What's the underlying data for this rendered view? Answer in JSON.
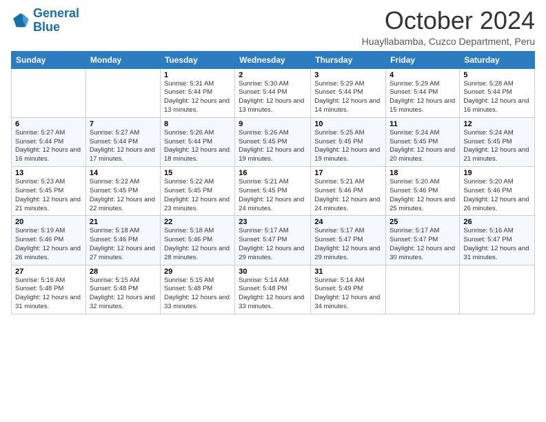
{
  "logo": {
    "line1": "General",
    "line2": "Blue"
  },
  "title": "October 2024",
  "subtitle": "Huayllabamba, Cuzco Department, Peru",
  "days_of_week": [
    "Sunday",
    "Monday",
    "Tuesday",
    "Wednesday",
    "Thursday",
    "Friday",
    "Saturday"
  ],
  "weeks": [
    [
      {
        "day": "",
        "info": ""
      },
      {
        "day": "",
        "info": ""
      },
      {
        "day": "1",
        "sunrise": "Sunrise: 5:31 AM",
        "sunset": "Sunset: 5:44 PM",
        "daylight": "Daylight: 12 hours and 13 minutes."
      },
      {
        "day": "2",
        "sunrise": "Sunrise: 5:30 AM",
        "sunset": "Sunset: 5:44 PM",
        "daylight": "Daylight: 12 hours and 13 minutes."
      },
      {
        "day": "3",
        "sunrise": "Sunrise: 5:29 AM",
        "sunset": "Sunset: 5:44 PM",
        "daylight": "Daylight: 12 hours and 14 minutes."
      },
      {
        "day": "4",
        "sunrise": "Sunrise: 5:29 AM",
        "sunset": "Sunset: 5:44 PM",
        "daylight": "Daylight: 12 hours and 15 minutes."
      },
      {
        "day": "5",
        "sunrise": "Sunrise: 5:28 AM",
        "sunset": "Sunset: 5:44 PM",
        "daylight": "Daylight: 12 hours and 16 minutes."
      }
    ],
    [
      {
        "day": "6",
        "sunrise": "Sunrise: 5:27 AM",
        "sunset": "Sunset: 5:44 PM",
        "daylight": "Daylight: 12 hours and 16 minutes."
      },
      {
        "day": "7",
        "sunrise": "Sunrise: 5:27 AM",
        "sunset": "Sunset: 5:44 PM",
        "daylight": "Daylight: 12 hours and 17 minutes."
      },
      {
        "day": "8",
        "sunrise": "Sunrise: 5:26 AM",
        "sunset": "Sunset: 5:44 PM",
        "daylight": "Daylight: 12 hours and 18 minutes."
      },
      {
        "day": "9",
        "sunrise": "Sunrise: 5:26 AM",
        "sunset": "Sunset: 5:45 PM",
        "daylight": "Daylight: 12 hours and 19 minutes."
      },
      {
        "day": "10",
        "sunrise": "Sunrise: 5:25 AM",
        "sunset": "Sunset: 5:45 PM",
        "daylight": "Daylight: 12 hours and 19 minutes."
      },
      {
        "day": "11",
        "sunrise": "Sunrise: 5:24 AM",
        "sunset": "Sunset: 5:45 PM",
        "daylight": "Daylight: 12 hours and 20 minutes."
      },
      {
        "day": "12",
        "sunrise": "Sunrise: 5:24 AM",
        "sunset": "Sunset: 5:45 PM",
        "daylight": "Daylight: 12 hours and 21 minutes."
      }
    ],
    [
      {
        "day": "13",
        "sunrise": "Sunrise: 5:23 AM",
        "sunset": "Sunset: 5:45 PM",
        "daylight": "Daylight: 12 hours and 21 minutes."
      },
      {
        "day": "14",
        "sunrise": "Sunrise: 5:22 AM",
        "sunset": "Sunset: 5:45 PM",
        "daylight": "Daylight: 12 hours and 22 minutes."
      },
      {
        "day": "15",
        "sunrise": "Sunrise: 5:22 AM",
        "sunset": "Sunset: 5:45 PM",
        "daylight": "Daylight: 12 hours and 23 minutes."
      },
      {
        "day": "16",
        "sunrise": "Sunrise: 5:21 AM",
        "sunset": "Sunset: 5:45 PM",
        "daylight": "Daylight: 12 hours and 24 minutes."
      },
      {
        "day": "17",
        "sunrise": "Sunrise: 5:21 AM",
        "sunset": "Sunset: 5:46 PM",
        "daylight": "Daylight: 12 hours and 24 minutes."
      },
      {
        "day": "18",
        "sunrise": "Sunrise: 5:20 AM",
        "sunset": "Sunset: 5:46 PM",
        "daylight": "Daylight: 12 hours and 25 minutes."
      },
      {
        "day": "19",
        "sunrise": "Sunrise: 5:20 AM",
        "sunset": "Sunset: 5:46 PM",
        "daylight": "Daylight: 12 hours and 26 minutes."
      }
    ],
    [
      {
        "day": "20",
        "sunrise": "Sunrise: 5:19 AM",
        "sunset": "Sunset: 5:46 PM",
        "daylight": "Daylight: 12 hours and 26 minutes."
      },
      {
        "day": "21",
        "sunrise": "Sunrise: 5:18 AM",
        "sunset": "Sunset: 5:46 PM",
        "daylight": "Daylight: 12 hours and 27 minutes."
      },
      {
        "day": "22",
        "sunrise": "Sunrise: 5:18 AM",
        "sunset": "Sunset: 5:46 PM",
        "daylight": "Daylight: 12 hours and 28 minutes."
      },
      {
        "day": "23",
        "sunrise": "Sunrise: 5:17 AM",
        "sunset": "Sunset: 5:47 PM",
        "daylight": "Daylight: 12 hours and 29 minutes."
      },
      {
        "day": "24",
        "sunrise": "Sunrise: 5:17 AM",
        "sunset": "Sunset: 5:47 PM",
        "daylight": "Daylight: 12 hours and 29 minutes."
      },
      {
        "day": "25",
        "sunrise": "Sunrise: 5:17 AM",
        "sunset": "Sunset: 5:47 PM",
        "daylight": "Daylight: 12 hours and 30 minutes."
      },
      {
        "day": "26",
        "sunrise": "Sunrise: 5:16 AM",
        "sunset": "Sunset: 5:47 PM",
        "daylight": "Daylight: 12 hours and 31 minutes."
      }
    ],
    [
      {
        "day": "27",
        "sunrise": "Sunrise: 5:16 AM",
        "sunset": "Sunset: 5:48 PM",
        "daylight": "Daylight: 12 hours and 31 minutes."
      },
      {
        "day": "28",
        "sunrise": "Sunrise: 5:15 AM",
        "sunset": "Sunset: 5:48 PM",
        "daylight": "Daylight: 12 hours and 32 minutes."
      },
      {
        "day": "29",
        "sunrise": "Sunrise: 5:15 AM",
        "sunset": "Sunset: 5:48 PM",
        "daylight": "Daylight: 12 hours and 33 minutes."
      },
      {
        "day": "30",
        "sunrise": "Sunrise: 5:14 AM",
        "sunset": "Sunset: 5:48 PM",
        "daylight": "Daylight: 12 hours and 33 minutes."
      },
      {
        "day": "31",
        "sunrise": "Sunrise: 5:14 AM",
        "sunset": "Sunset: 5:49 PM",
        "daylight": "Daylight: 12 hours and 34 minutes."
      },
      {
        "day": "",
        "info": ""
      },
      {
        "day": "",
        "info": ""
      }
    ]
  ],
  "accent_color": "#2d7cbf"
}
